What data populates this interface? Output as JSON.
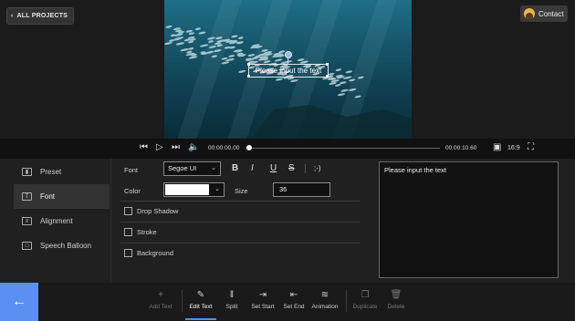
{
  "header": {
    "back_label": "ALL PROJECTS",
    "back_icon": "chevron-left-icon",
    "contact_label": "Contact"
  },
  "video": {
    "overlay_text": "Please input the text"
  },
  "playback": {
    "current_time": "00:00:00.00",
    "total_time": "00:00:10.60",
    "aspect_ratio": "16:9",
    "progress": 0
  },
  "sidebar": {
    "items": [
      {
        "label": "Preset",
        "icon": "preset-icon",
        "active": false
      },
      {
        "label": "Font",
        "icon": "font-icon",
        "active": true
      },
      {
        "label": "Alignment",
        "icon": "alignment-icon",
        "active": false
      },
      {
        "label": "Speech Balloon",
        "icon": "speech-balloon-icon",
        "active": false
      }
    ]
  },
  "settings": {
    "font_label": "Font",
    "font_value": "Segoe UI",
    "color_label": "Color",
    "color_value": "#ffffff",
    "size_label": "Size",
    "size_value": "36",
    "format_buttons": [
      "B",
      "I",
      "U",
      "S",
      ";-)"
    ],
    "options": [
      {
        "label": "Drop Shadow",
        "checked": false
      },
      {
        "label": "Stroke",
        "checked": false
      },
      {
        "label": "Background",
        "checked": false
      }
    ]
  },
  "text_input": {
    "value": "Please input the text"
  },
  "toolbar": {
    "tools": [
      {
        "label": "Add Text",
        "icon": "plus-icon",
        "state": "disabled"
      },
      {
        "label": "Edit Text",
        "icon": "edit-icon",
        "state": "active"
      },
      {
        "label": "Split",
        "icon": "split-icon",
        "state": "normal"
      },
      {
        "label": "Set Start",
        "icon": "set-start-icon",
        "state": "normal"
      },
      {
        "label": "Set End",
        "icon": "set-end-icon",
        "state": "normal"
      },
      {
        "label": "Animation",
        "icon": "animation-icon",
        "state": "normal"
      },
      {
        "label": "Duplicate",
        "icon": "duplicate-icon",
        "state": "disabled"
      },
      {
        "label": "Delete",
        "icon": "delete-icon",
        "state": "disabled"
      }
    ]
  },
  "colors": {
    "accent": "#5b8ff2",
    "panel": "#202020",
    "background": "#1a1a1a"
  }
}
